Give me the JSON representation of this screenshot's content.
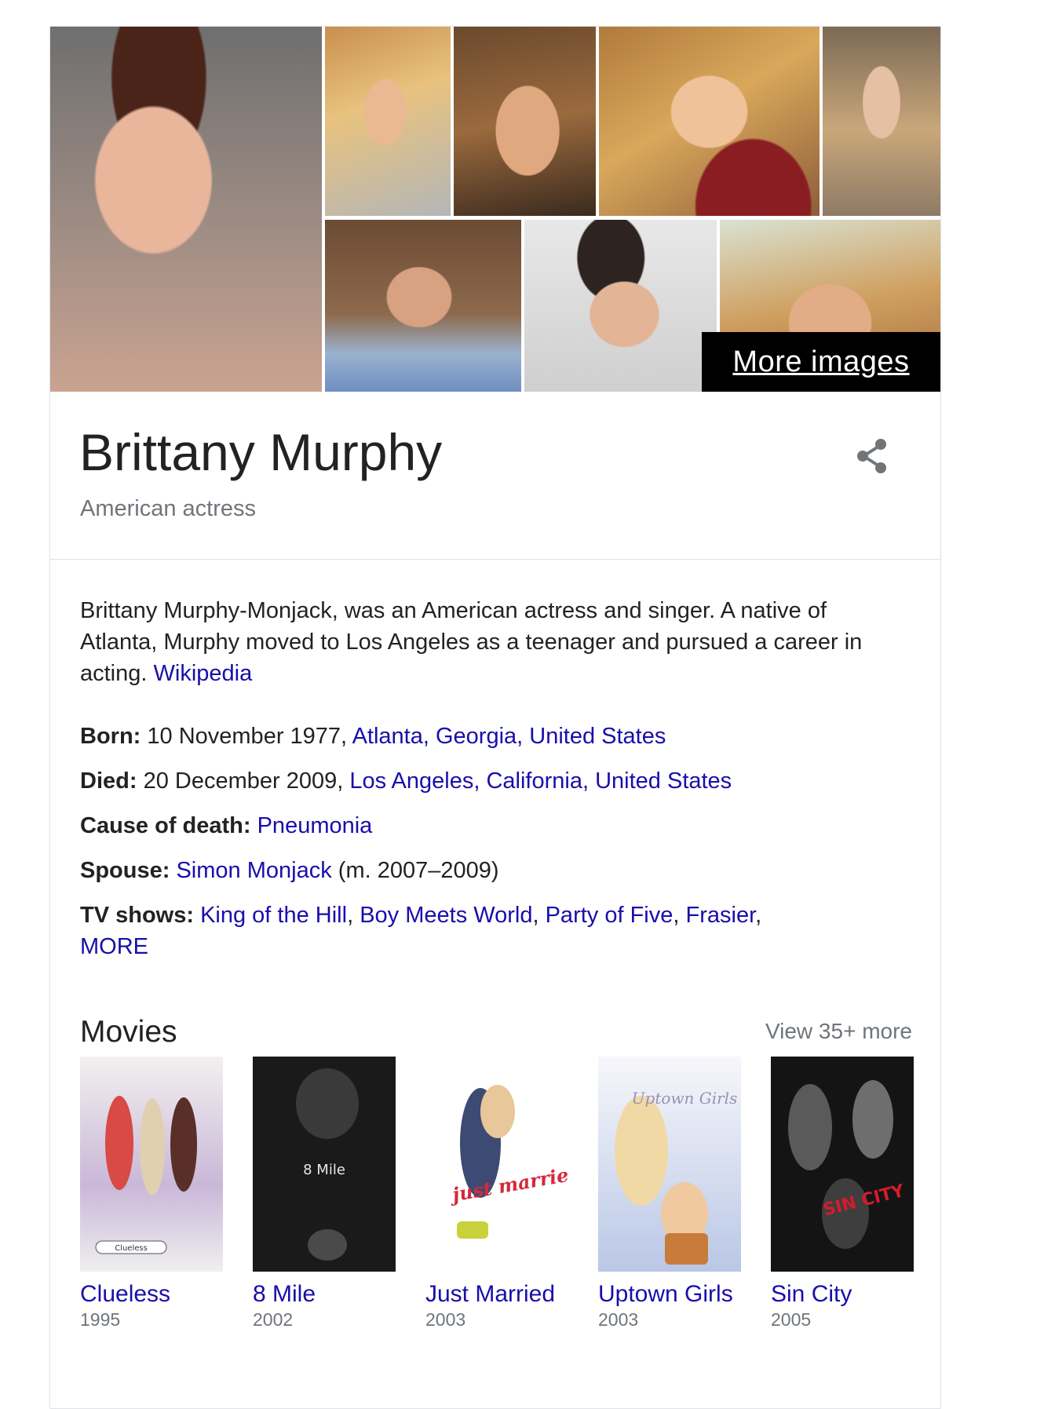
{
  "images": {
    "more_label": "More images"
  },
  "header": {
    "title": "Brittany Murphy",
    "subtitle": "American actress"
  },
  "description": {
    "text": "Brittany Murphy-Monjack, was an American actress and singer. A native of Atlanta, Murphy moved to Los Angeles as a teenager and pursued a career in acting.",
    "source": "Wikipedia"
  },
  "facts": {
    "born": {
      "label": "Born:",
      "date": "10 November 1977,",
      "place": "Atlanta, Georgia, United States"
    },
    "died": {
      "label": "Died:",
      "date": "20 December 2009,",
      "place": "Los Angeles, California, United States"
    },
    "cause": {
      "label": "Cause of death:",
      "value": "Pneumonia"
    },
    "spouse": {
      "label": "Spouse:",
      "name": "Simon Monjack",
      "years": "(m. 2007–2009)"
    },
    "tv": {
      "label": "TV shows:",
      "shows": [
        "King of the Hill",
        "Boy Meets World",
        "Party of Five",
        "Frasier"
      ],
      "more": "MORE"
    }
  },
  "movies": {
    "heading": "Movies",
    "view_more": "View 35+ more",
    "items": [
      {
        "title": "Clueless",
        "year": "1995",
        "poster_text": "Clueless"
      },
      {
        "title": "8 Mile",
        "year": "2002",
        "poster_text": "8 Mile"
      },
      {
        "title": "Just Married",
        "year": "2003",
        "poster_text": "just married"
      },
      {
        "title": "Uptown Girls",
        "year": "2003",
        "poster_text": "Uptown Girls"
      },
      {
        "title": "Sin City",
        "year": "2005",
        "poster_text": "SIN CITY"
      }
    ]
  },
  "colors": {
    "link": "#1a0dab",
    "secondary_text": "#70757a",
    "border": "#dfe1e5"
  }
}
